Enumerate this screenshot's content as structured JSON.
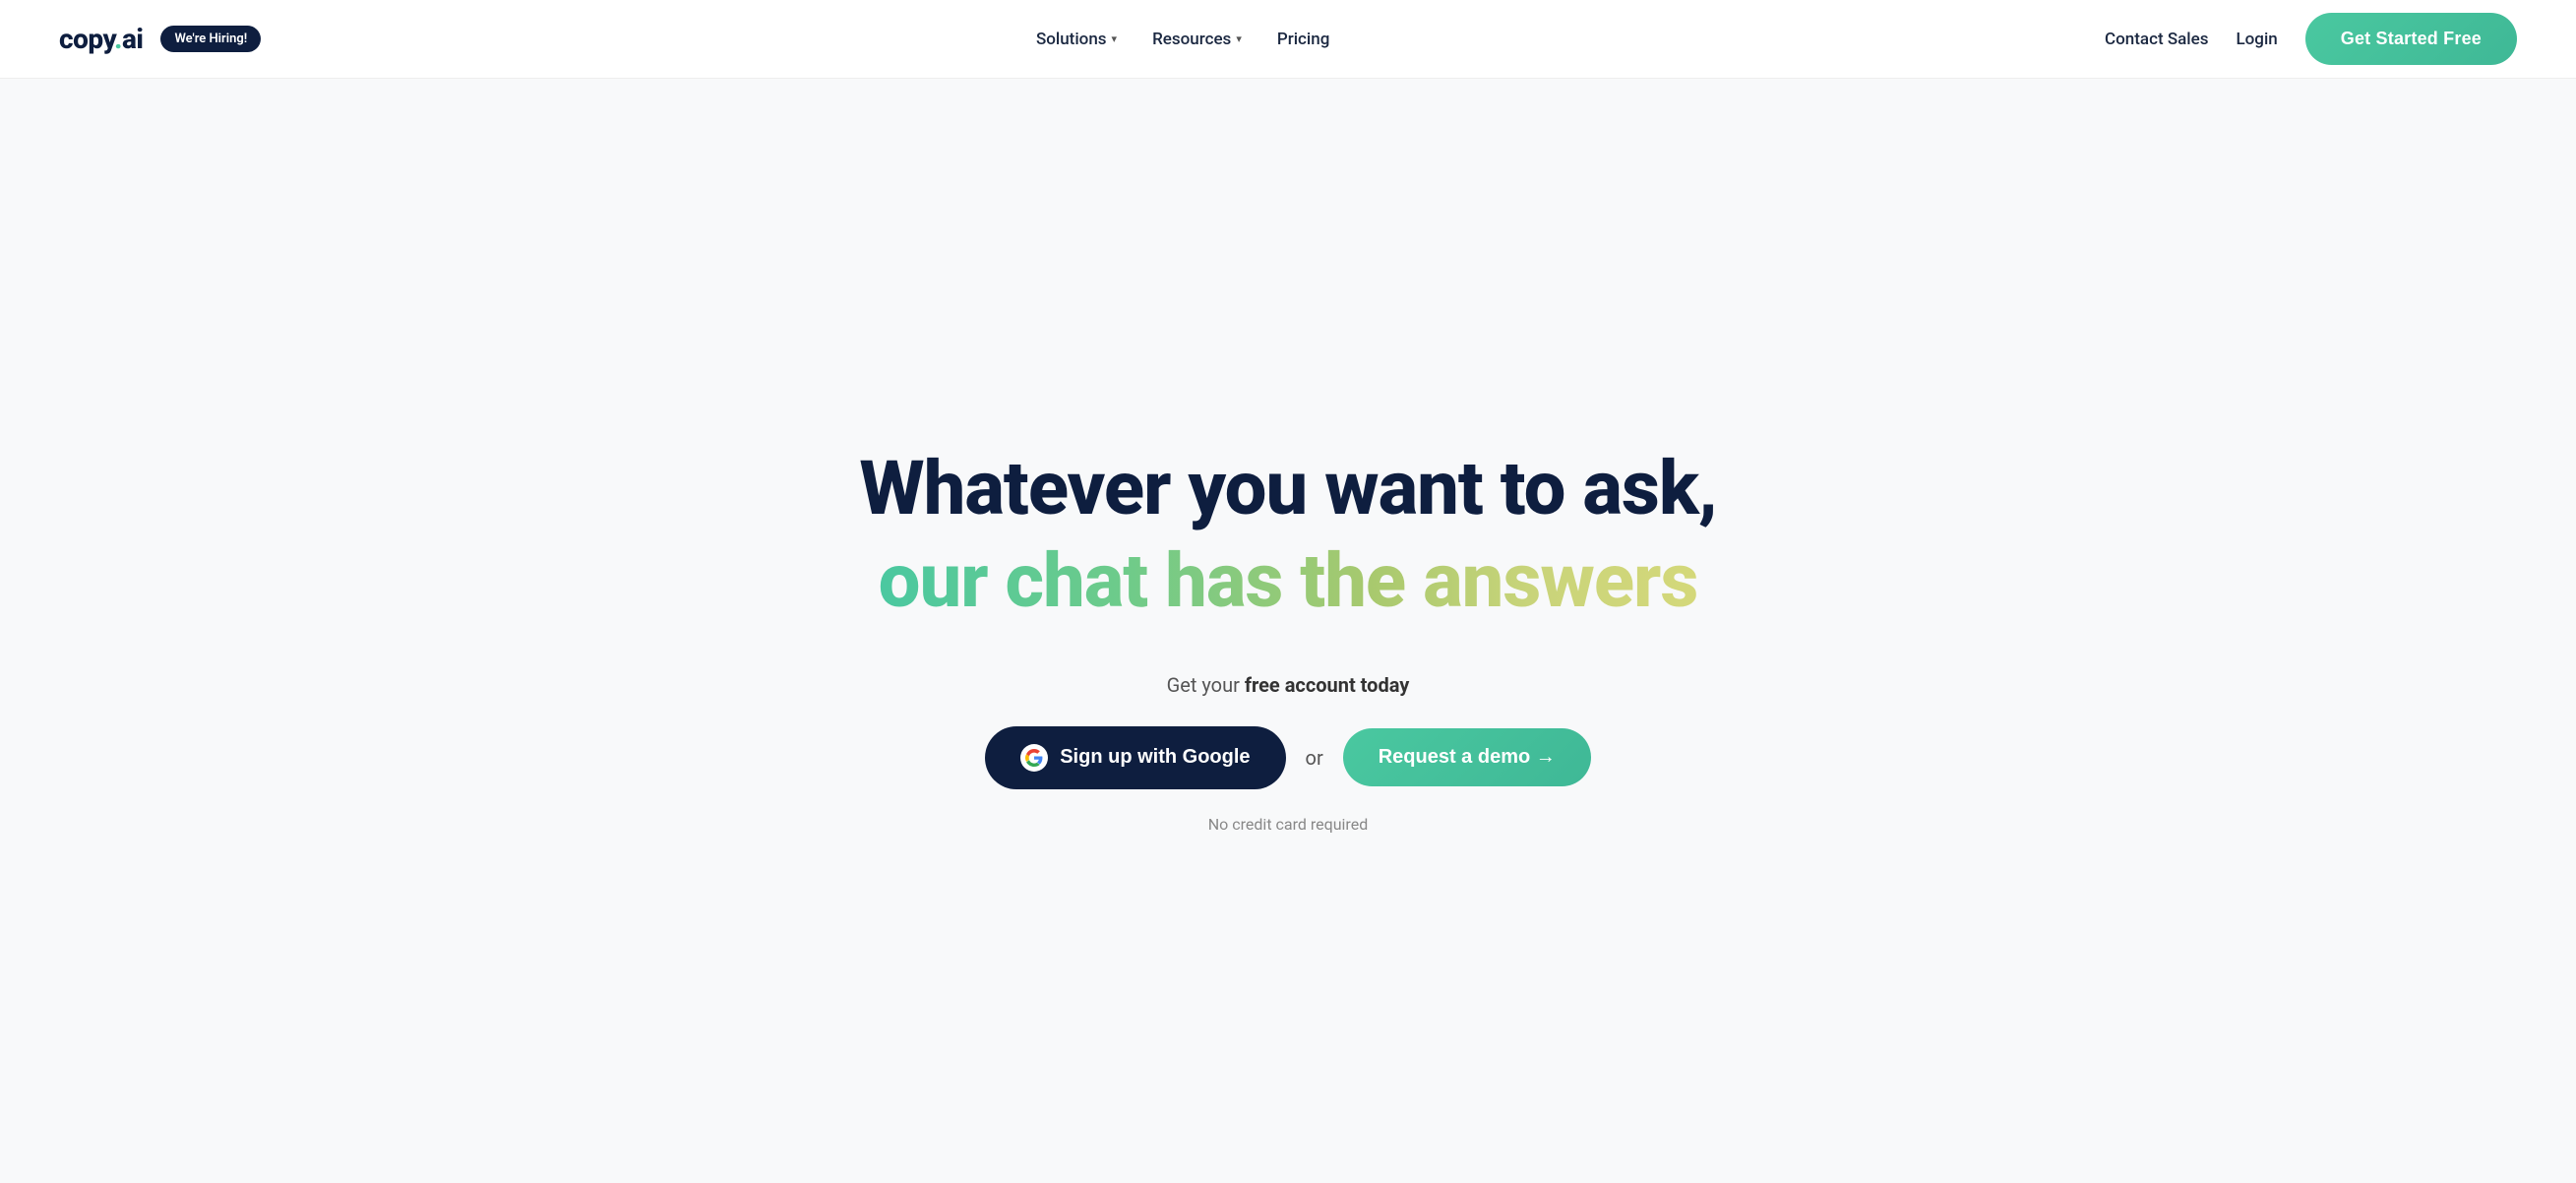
{
  "brand": {
    "name_part1": "copy",
    "name_dot": ".",
    "name_part2": "ai"
  },
  "navbar": {
    "hiring_badge": "We're Hiring!",
    "nav_items": [
      {
        "label": "Solutions",
        "has_dropdown": true
      },
      {
        "label": "Resources",
        "has_dropdown": true
      },
      {
        "label": "Pricing",
        "has_dropdown": false
      }
    ],
    "contact_sales": "Contact Sales",
    "login": "Login",
    "get_started": "Get Started Free"
  },
  "hero": {
    "headline_line1": "Whatever you want to ask,",
    "headline_line2": "our chat has the answers",
    "cta_text_plain": "Get your ",
    "cta_text_bold": "free account today",
    "google_button": "Sign up with Google",
    "or_label": "or",
    "demo_button": "Request a demo →",
    "no_credit_card": "No credit card required"
  }
}
